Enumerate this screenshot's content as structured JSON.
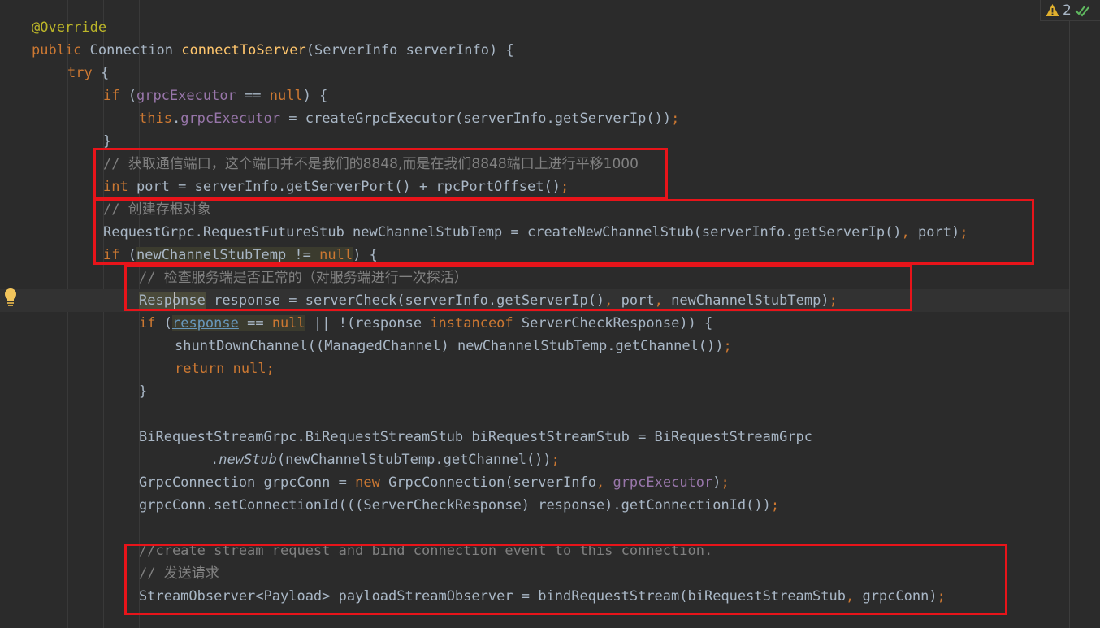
{
  "inspection": {
    "warning_count": "2"
  },
  "code": {
    "l1": "@Override",
    "l2_kw": "public",
    "l2_type": " Connection ",
    "l2_fn": "connectToServer",
    "l2_rest": "(ServerInfo serverInfo) {",
    "l3_kw": "try",
    "l3_rest": " {",
    "l4_kw": "if",
    "l4_a": " (",
    "l4_field": "grpcExecutor",
    "l4_b": " == ",
    "l4_null": "null",
    "l4_c": ") {",
    "l5_this": "this",
    "l5_dot": ".",
    "l5_field": "grpcExecutor",
    "l5_rest": " = createGrpcExecutor(serverInfo.getServerIp())",
    "l5_semi": ";",
    "l6": "}",
    "l7_a": "// ",
    "l7_b": "获取通信端口，这个端口并不是我们的8848,而是在我们8848端口上进行平移1000",
    "l8_kw": "int",
    "l8_rest": " port = serverInfo.getServerPort() + rpcPortOffset()",
    "l8_semi": ";",
    "l9_a": "// ",
    "l9_b": "创建存根对象",
    "l10_a": "RequestGrpc.RequestFutureStub newChannelStubTemp = createNewChannelStub(serverInfo.getServerIp()",
    "l10_comma": ",",
    "l10_b": " port)",
    "l10_semi": ";",
    "l11_kw": "if",
    "l11_a": " (",
    "l11_hl": "newChannelStubTemp != ",
    "l11_null": "null",
    "l11_b": ") {",
    "l12_a": "// ",
    "l12_b": "检查服务端是否正常的（对服务端进行一次探活）",
    "l13_hl": "Response",
    "l13_a": " response = serverCheck(serverInfo.getServerIp()",
    "l13_c1": ",",
    "l13_b": " port",
    "l13_c2": ",",
    "l13_c": " newChannelStubTemp)",
    "l13_semi": ";",
    "l14_kw": "if",
    "l14_a": " (",
    "l14_link": "response",
    "l14_b": " == ",
    "l14_null": "null",
    "l14_c": " || !(response ",
    "l14_inst": "instanceof",
    "l14_d": " ServerCheckResponse)) {",
    "l15_a": "shuntDownChannel((ManagedChannel) newChannelStubTemp.getChannel())",
    "l15_semi": ";",
    "l16_kw": "return",
    "l16_null": " null",
    "l16_semi": ";",
    "l17": "}",
    "l19": "BiRequestStreamGrpc.BiRequestStreamStub biRequestStreamStub = BiRequestStreamGrpc",
    "l20_dot": ".",
    "l20_it": "newStub",
    "l20_rest": "(newChannelStubTemp.getChannel())",
    "l20_semi": ";",
    "l21_a": "GrpcConnection grpcConn = ",
    "l21_new": "new",
    "l21_b": " GrpcConnection(serverInfo",
    "l21_comma": ",",
    "l21_sp": " ",
    "l21_field": "grpcExecutor",
    "l21_c": ")",
    "l21_semi": ";",
    "l22_a": "grpcConn.setConnectionId(((ServerCheckResponse) response).getConnectionId())",
    "l22_semi": ";",
    "l24": "//create stream request and bind connection event to this connection.",
    "l25_a": "// ",
    "l25_b": "发送请求",
    "l26_a": "StreamObserver<Payload> payloadStreamObserver = bindRequestStream(biRequestStreamStub",
    "l26_comma": ",",
    "l26_b": " grpcConn)",
    "l26_semi": ";"
  }
}
